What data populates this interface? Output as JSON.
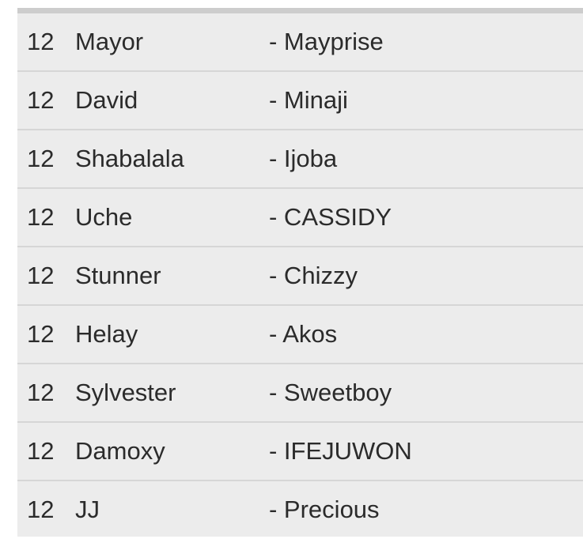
{
  "rows": [
    {
      "number": "12",
      "name": "Mayor",
      "partner": "- Mayprise"
    },
    {
      "number": "12",
      "name": "David",
      "partner": "- Minaji"
    },
    {
      "number": "12",
      "name": "Shabalala",
      "partner": "- Ijoba"
    },
    {
      "number": "12",
      "name": "Uche",
      "partner": "- CASSIDY"
    },
    {
      "number": "12",
      "name": "Stunner",
      "partner": "- Chizzy"
    },
    {
      "number": "12",
      "name": "Helay",
      "partner": "- Akos"
    },
    {
      "number": "12",
      "name": "Sylvester",
      "partner": "- Sweetboy"
    },
    {
      "number": "12",
      "name": "Damoxy",
      "partner": "- IFEJUWON"
    },
    {
      "number": "12",
      "name": "JJ",
      "partner": "- Precious"
    }
  ]
}
